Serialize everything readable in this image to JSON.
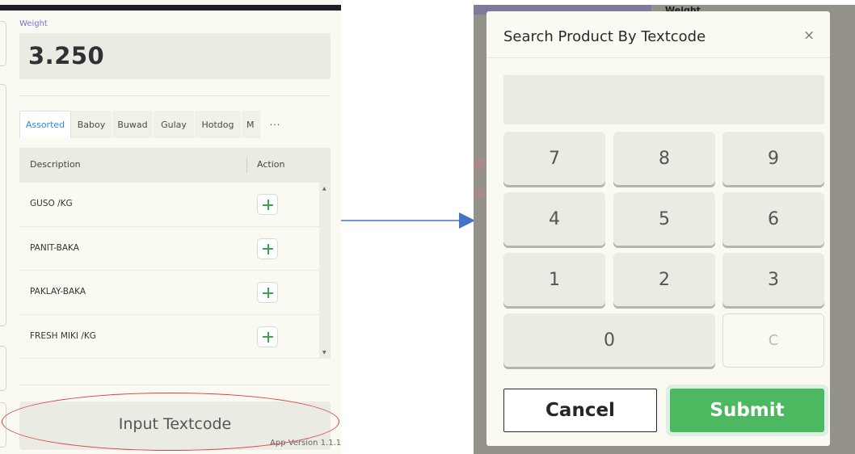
{
  "left_panel": {
    "weight_label": "Weight",
    "weight_value": "3.250",
    "tabs": [
      "Assorted",
      "Baboy",
      "Buwad",
      "Gulay",
      "Hotdog",
      "M"
    ],
    "tabs_more": "···",
    "active_tab": "Assorted",
    "table": {
      "columns": [
        "Description",
        "Action"
      ],
      "rows": [
        "GUSO /KG",
        "PANIT-BAKA",
        "PAKLAY-BAKA",
        "FRESH MIKI /KG"
      ]
    },
    "input_textcode_label": "Input Textcode",
    "app_version": "App Version 1.1.1"
  },
  "right_panel": {
    "background_weight_label": "Weight",
    "modal": {
      "title": "Search Product By Textcode",
      "close_symbol": "×",
      "input_value": "",
      "keys": [
        "7",
        "8",
        "9",
        "4",
        "5",
        "6",
        "1",
        "2",
        "3",
        "0",
        "C"
      ],
      "cancel_label": "Cancel",
      "submit_label": "Submit"
    }
  },
  "colors": {
    "accent_tab": "#2a8fd8",
    "add_icon": "#3aa356",
    "submit": "#4cb860",
    "annotation_ellipse": "#d94040",
    "annotation_arrow": "#4472c4"
  }
}
